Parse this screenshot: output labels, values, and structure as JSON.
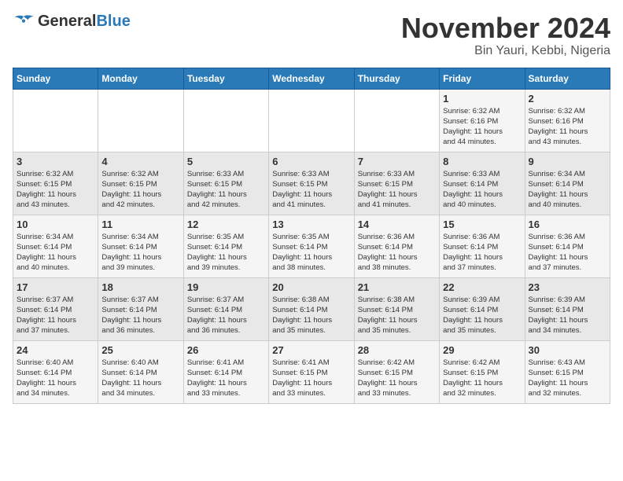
{
  "logo": {
    "text_general": "General",
    "text_blue": "Blue"
  },
  "title": "November 2024",
  "subtitle": "Bin Yauri, Kebbi, Nigeria",
  "days_of_week": [
    "Sunday",
    "Monday",
    "Tuesday",
    "Wednesday",
    "Thursday",
    "Friday",
    "Saturday"
  ],
  "weeks": [
    [
      {
        "day": "",
        "info": ""
      },
      {
        "day": "",
        "info": ""
      },
      {
        "day": "",
        "info": ""
      },
      {
        "day": "",
        "info": ""
      },
      {
        "day": "",
        "info": ""
      },
      {
        "day": "1",
        "info": "Sunrise: 6:32 AM\nSunset: 6:16 PM\nDaylight: 11 hours\nand 44 minutes."
      },
      {
        "day": "2",
        "info": "Sunrise: 6:32 AM\nSunset: 6:16 PM\nDaylight: 11 hours\nand 43 minutes."
      }
    ],
    [
      {
        "day": "3",
        "info": "Sunrise: 6:32 AM\nSunset: 6:15 PM\nDaylight: 11 hours\nand 43 minutes."
      },
      {
        "day": "4",
        "info": "Sunrise: 6:32 AM\nSunset: 6:15 PM\nDaylight: 11 hours\nand 42 minutes."
      },
      {
        "day": "5",
        "info": "Sunrise: 6:33 AM\nSunset: 6:15 PM\nDaylight: 11 hours\nand 42 minutes."
      },
      {
        "day": "6",
        "info": "Sunrise: 6:33 AM\nSunset: 6:15 PM\nDaylight: 11 hours\nand 41 minutes."
      },
      {
        "day": "7",
        "info": "Sunrise: 6:33 AM\nSunset: 6:15 PM\nDaylight: 11 hours\nand 41 minutes."
      },
      {
        "day": "8",
        "info": "Sunrise: 6:33 AM\nSunset: 6:14 PM\nDaylight: 11 hours\nand 40 minutes."
      },
      {
        "day": "9",
        "info": "Sunrise: 6:34 AM\nSunset: 6:14 PM\nDaylight: 11 hours\nand 40 minutes."
      }
    ],
    [
      {
        "day": "10",
        "info": "Sunrise: 6:34 AM\nSunset: 6:14 PM\nDaylight: 11 hours\nand 40 minutes."
      },
      {
        "day": "11",
        "info": "Sunrise: 6:34 AM\nSunset: 6:14 PM\nDaylight: 11 hours\nand 39 minutes."
      },
      {
        "day": "12",
        "info": "Sunrise: 6:35 AM\nSunset: 6:14 PM\nDaylight: 11 hours\nand 39 minutes."
      },
      {
        "day": "13",
        "info": "Sunrise: 6:35 AM\nSunset: 6:14 PM\nDaylight: 11 hours\nand 38 minutes."
      },
      {
        "day": "14",
        "info": "Sunrise: 6:36 AM\nSunset: 6:14 PM\nDaylight: 11 hours\nand 38 minutes."
      },
      {
        "day": "15",
        "info": "Sunrise: 6:36 AM\nSunset: 6:14 PM\nDaylight: 11 hours\nand 37 minutes."
      },
      {
        "day": "16",
        "info": "Sunrise: 6:36 AM\nSunset: 6:14 PM\nDaylight: 11 hours\nand 37 minutes."
      }
    ],
    [
      {
        "day": "17",
        "info": "Sunrise: 6:37 AM\nSunset: 6:14 PM\nDaylight: 11 hours\nand 37 minutes."
      },
      {
        "day": "18",
        "info": "Sunrise: 6:37 AM\nSunset: 6:14 PM\nDaylight: 11 hours\nand 36 minutes."
      },
      {
        "day": "19",
        "info": "Sunrise: 6:37 AM\nSunset: 6:14 PM\nDaylight: 11 hours\nand 36 minutes."
      },
      {
        "day": "20",
        "info": "Sunrise: 6:38 AM\nSunset: 6:14 PM\nDaylight: 11 hours\nand 35 minutes."
      },
      {
        "day": "21",
        "info": "Sunrise: 6:38 AM\nSunset: 6:14 PM\nDaylight: 11 hours\nand 35 minutes."
      },
      {
        "day": "22",
        "info": "Sunrise: 6:39 AM\nSunset: 6:14 PM\nDaylight: 11 hours\nand 35 minutes."
      },
      {
        "day": "23",
        "info": "Sunrise: 6:39 AM\nSunset: 6:14 PM\nDaylight: 11 hours\nand 34 minutes."
      }
    ],
    [
      {
        "day": "24",
        "info": "Sunrise: 6:40 AM\nSunset: 6:14 PM\nDaylight: 11 hours\nand 34 minutes."
      },
      {
        "day": "25",
        "info": "Sunrise: 6:40 AM\nSunset: 6:14 PM\nDaylight: 11 hours\nand 34 minutes."
      },
      {
        "day": "26",
        "info": "Sunrise: 6:41 AM\nSunset: 6:14 PM\nDaylight: 11 hours\nand 33 minutes."
      },
      {
        "day": "27",
        "info": "Sunrise: 6:41 AM\nSunset: 6:15 PM\nDaylight: 11 hours\nand 33 minutes."
      },
      {
        "day": "28",
        "info": "Sunrise: 6:42 AM\nSunset: 6:15 PM\nDaylight: 11 hours\nand 33 minutes."
      },
      {
        "day": "29",
        "info": "Sunrise: 6:42 AM\nSunset: 6:15 PM\nDaylight: 11 hours\nand 32 minutes."
      },
      {
        "day": "30",
        "info": "Sunrise: 6:43 AM\nSunset: 6:15 PM\nDaylight: 11 hours\nand 32 minutes."
      }
    ]
  ]
}
